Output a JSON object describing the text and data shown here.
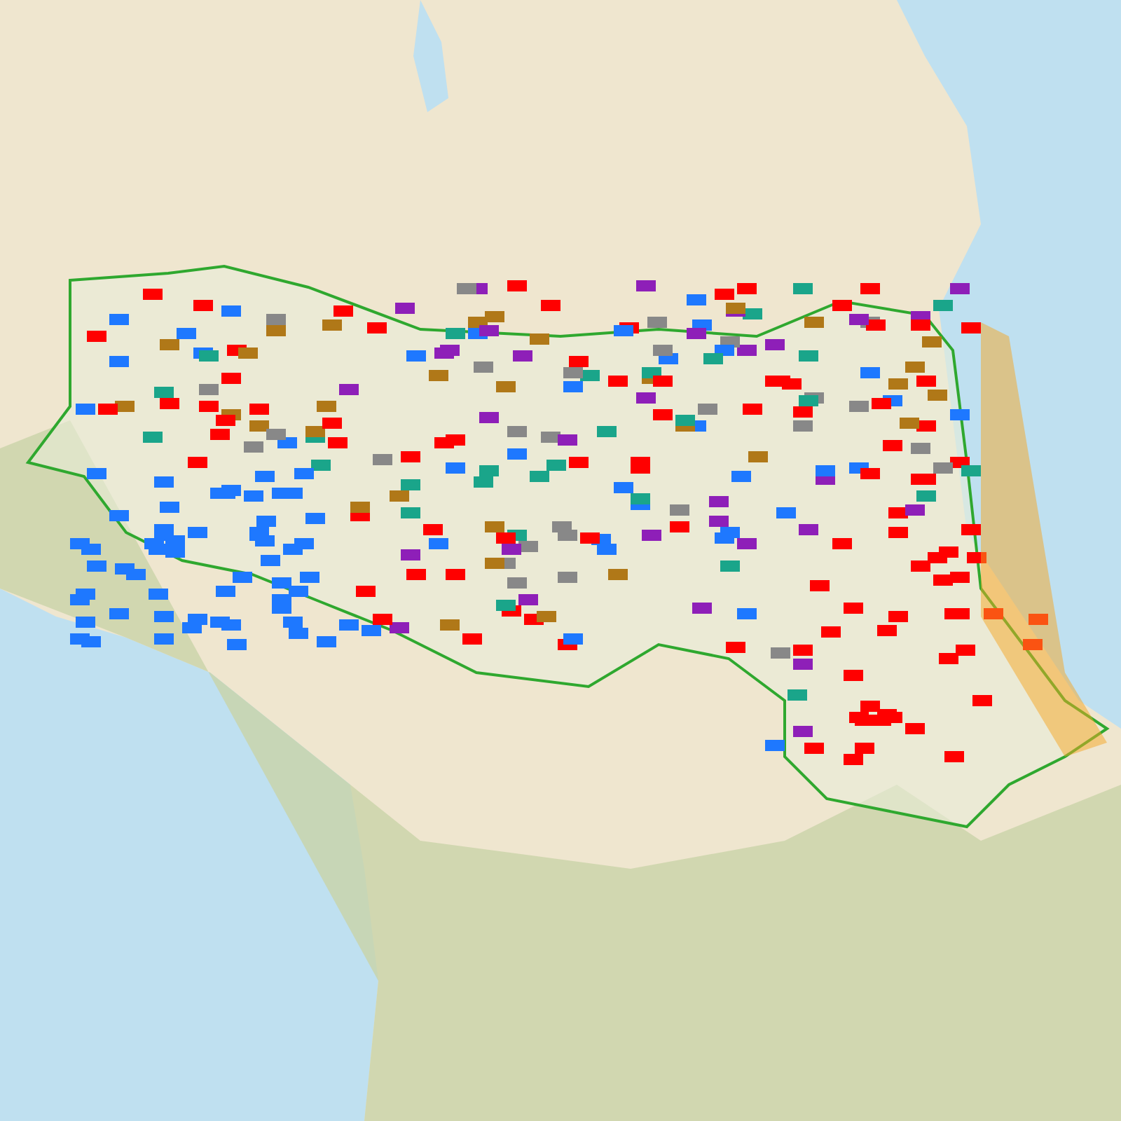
{
  "map": {
    "kind": "topographic"
  }
}
